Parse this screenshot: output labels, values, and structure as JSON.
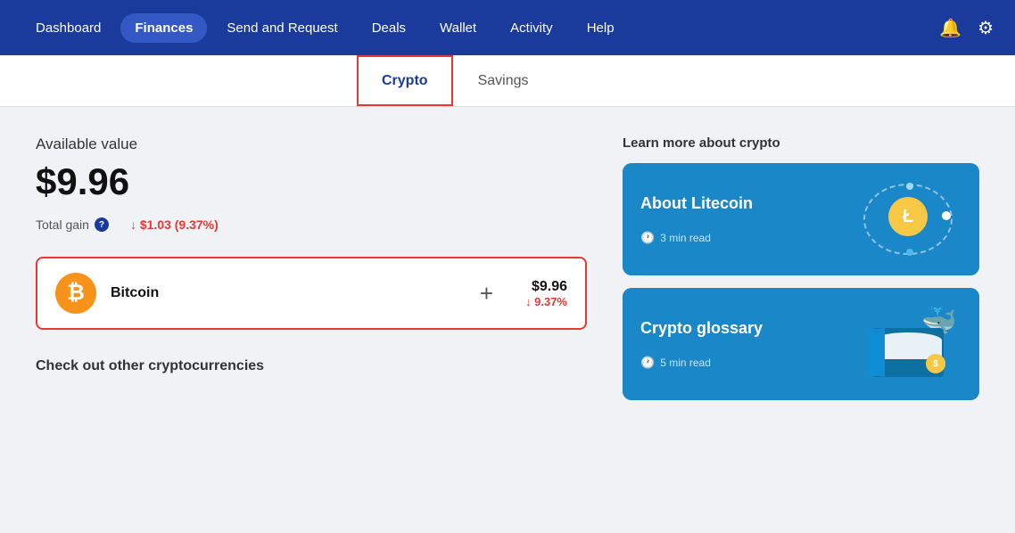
{
  "navbar": {
    "items": [
      {
        "label": "Dashboard",
        "active": false
      },
      {
        "label": "Finances",
        "active": true
      },
      {
        "label": "Send and Request",
        "active": false
      },
      {
        "label": "Deals",
        "active": false
      },
      {
        "label": "Wallet",
        "active": false
      },
      {
        "label": "Activity",
        "active": false
      },
      {
        "label": "Help",
        "active": false
      }
    ]
  },
  "tabs": [
    {
      "label": "Crypto",
      "active": true
    },
    {
      "label": "Savings",
      "active": false
    }
  ],
  "main": {
    "available_label": "Available value",
    "available_value": "$9.96",
    "total_gain_label": "Total gain",
    "total_gain_value": "↓ $1.03 (9.37%)",
    "bitcoin": {
      "name": "Bitcoin",
      "usd": "$9.96",
      "pct": "↓ 9.37%"
    },
    "check_out_label": "Check out other cryptocurrencies"
  },
  "sidebar": {
    "learn_title": "Learn more about crypto",
    "cards": [
      {
        "title": "About Litecoin",
        "time": "3 min read"
      },
      {
        "title": "Crypto glossary",
        "time": "5 min read"
      }
    ]
  }
}
